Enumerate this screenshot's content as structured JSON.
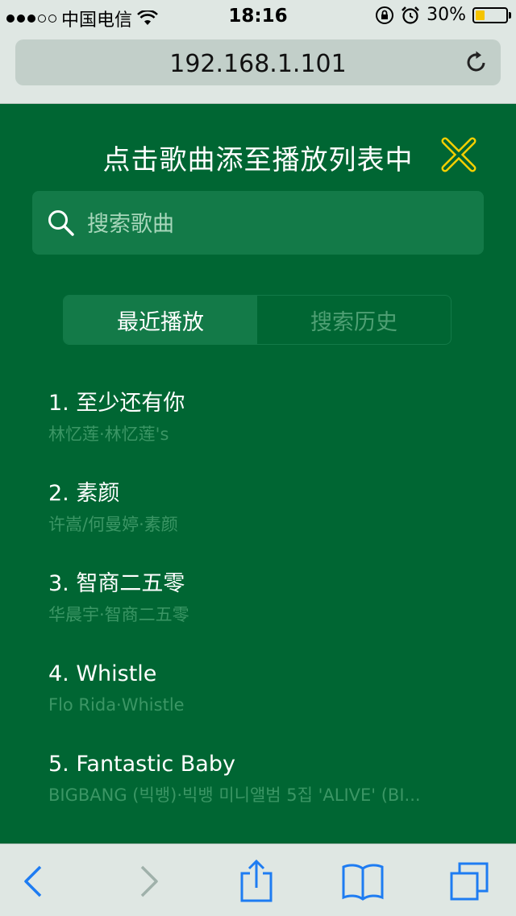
{
  "status_bar": {
    "carrier": "中国电信",
    "time": "18:16",
    "battery": "30%",
    "battery_level": 0.3
  },
  "browser": {
    "url": "192.168.1.101"
  },
  "panel": {
    "title": "点击歌曲添至播放列表中",
    "search_placeholder": "搜索歌曲",
    "tabs": [
      {
        "label": "最近播放",
        "active": true
      },
      {
        "label": "搜索历史",
        "active": false
      }
    ],
    "songs": [
      {
        "title": "1. 至少还有你",
        "subtitle": "林忆莲·林忆莲's"
      },
      {
        "title": "2. 素颜",
        "subtitle": "许嵩/何曼婷·素颜"
      },
      {
        "title": "3. 智商二五零",
        "subtitle": "华晨宇·智商二五零"
      },
      {
        "title": "4. Whistle",
        "subtitle": "Flo Rida·Whistle"
      },
      {
        "title": "5. Fantastic Baby",
        "subtitle": "BIGBANG (빅뱅)·빅뱅 미니앨범 5집 'ALIVE' (BI..."
      }
    ]
  },
  "colors": {
    "background": "#006633",
    "accent": "#f5d000",
    "toolbar_icon": "#1e7cf2"
  },
  "icons": [
    "wifi-icon",
    "orientation-lock-icon",
    "alarm-icon",
    "battery-icon",
    "reload-icon",
    "close-icon",
    "search-icon",
    "back-icon",
    "forward-icon",
    "share-icon",
    "bookmarks-icon",
    "tabs-icon"
  ]
}
